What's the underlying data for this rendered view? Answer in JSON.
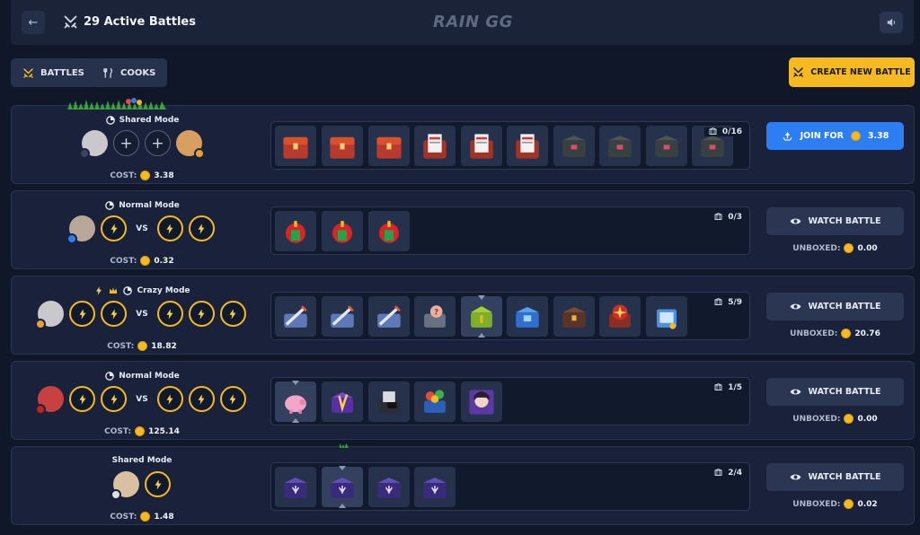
{
  "header": {
    "title": "29 Active Battles",
    "logo": "RAIN GG"
  },
  "tabs": [
    {
      "label": "BATTLES",
      "icon": "swords-icon"
    },
    {
      "label": "COOKS",
      "icon": "utensils-icon"
    }
  ],
  "create_button": {
    "label": "CREATE NEW BATTLE"
  },
  "labels": {
    "cost": "COST:",
    "unboxed": "UNBOXED:",
    "vs": "VS"
  },
  "battles": [
    {
      "mode": "Shared Mode",
      "cost": "3.38",
      "counter": "0/16",
      "action": "JOIN FOR",
      "action_value": "3.38",
      "unboxed": null
    },
    {
      "mode": "Normal Mode",
      "cost": "0.32",
      "counter": "0/3",
      "action": "WATCH BATTLE",
      "unboxed": "0.00"
    },
    {
      "mode": "Crazy Mode",
      "cost": "18.82",
      "counter": "5/9",
      "action": "WATCH BATTLE",
      "unboxed": "20.76"
    },
    {
      "mode": "Normal Mode",
      "cost": "125.14",
      "counter": "1/5",
      "action": "WATCH BATTLE",
      "unboxed": "0.00"
    },
    {
      "mode": "Shared Mode",
      "cost": "1.48",
      "counter": "2/4",
      "action": "WATCH BATTLE",
      "unboxed": "0.02"
    }
  ],
  "colors": {
    "accent": "#f5b921",
    "join": "#2b7ff3",
    "background": "#101728",
    "panel": "#19223a"
  }
}
